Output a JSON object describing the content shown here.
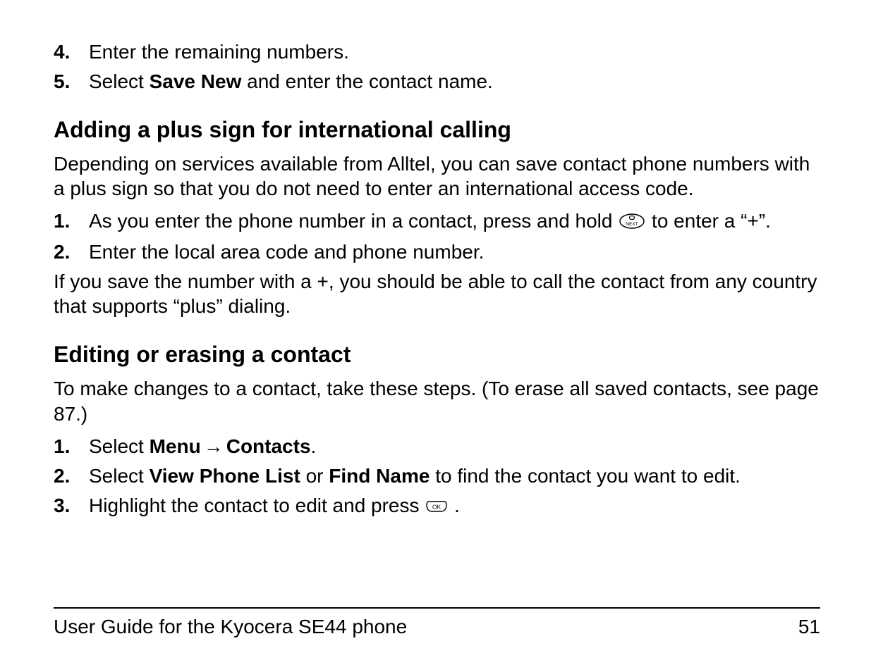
{
  "top_steps": [
    {
      "n": "4.",
      "text": "Enter the remaining numbers."
    },
    {
      "n": "5.",
      "prefix": "Select ",
      "bold": "Save New",
      "suffix": " and enter the contact name."
    }
  ],
  "section_plus": {
    "heading": "Adding a plus sign for international calling",
    "intro": "Depending on services available from Alltel, you can save contact phone numbers with a plus sign so that you do not need to enter an international access code.",
    "steps": [
      {
        "n": "1.",
        "before": "As you enter the phone number in a contact, press and hold ",
        "icon": "next",
        "after": " to enter a “+”."
      },
      {
        "n": "2.",
        "text": "Enter the local area code and phone number."
      }
    ],
    "note": "If you save the number with a +, you should be able to call the contact from any country that supports “plus” dialing."
  },
  "section_edit": {
    "heading": "Editing or erasing a contact",
    "intro": "To make changes to a contact, take these steps. (To erase all saved contacts, see page 87.)",
    "steps": {
      "s1": {
        "n": "1.",
        "prefix": "Select ",
        "b1": "Menu",
        "arrow": "→",
        "b2": "Contacts",
        "suffix": "."
      },
      "s2": {
        "n": "2.",
        "prefix": "Select ",
        "b1": "View Phone List",
        "mid": " or ",
        "b2": "Find Name",
        "suffix": " to find the contact you want to edit."
      },
      "s3": {
        "n": "3.",
        "before": "Highlight the contact to edit and press ",
        "icon": "ok",
        "after": "."
      }
    }
  },
  "footer": {
    "left": "User Guide for the Kyocera SE44 phone",
    "right": "51"
  }
}
